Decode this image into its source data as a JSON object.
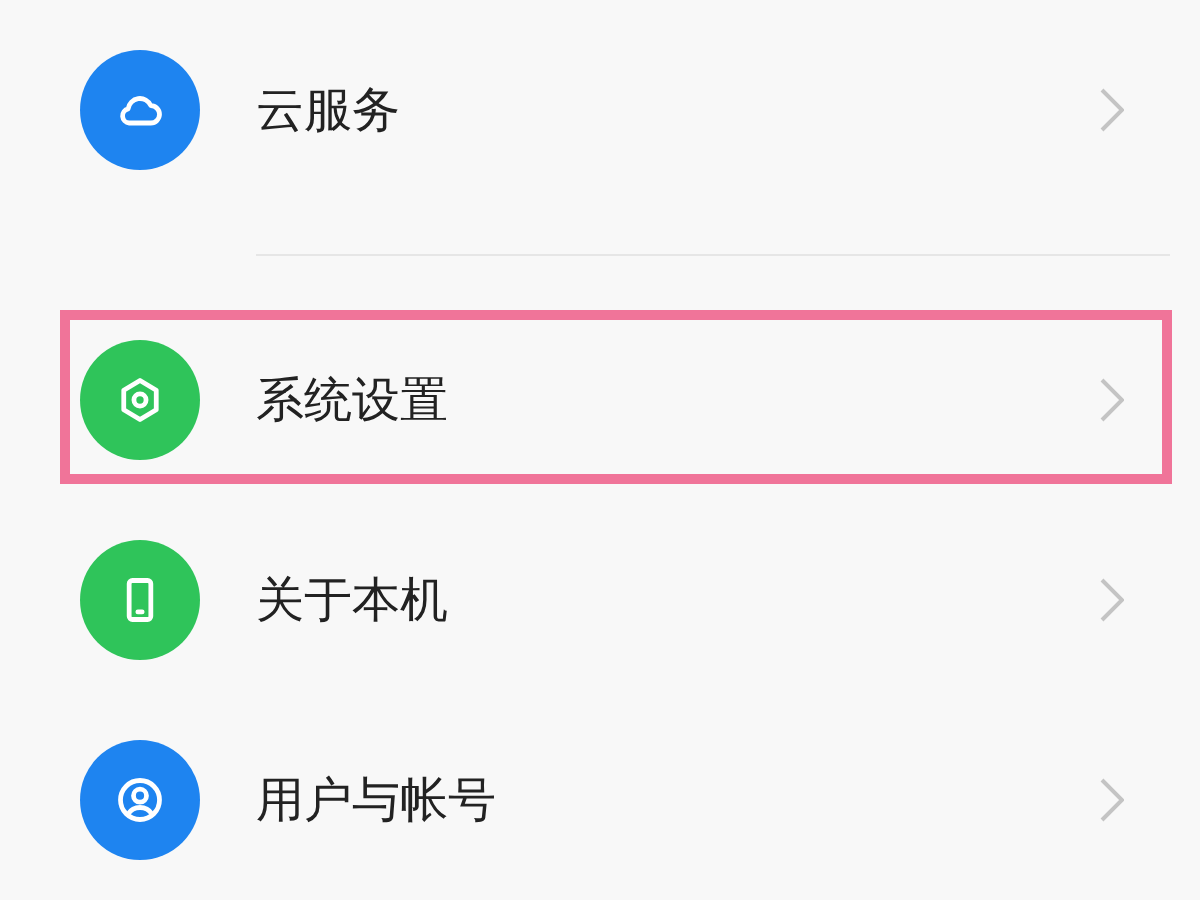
{
  "sections": [
    {
      "items": [
        {
          "label": "云服务",
          "color": "#1e84f0",
          "highlighted": false
        }
      ]
    },
    {
      "items": [
        {
          "label": "系统设置",
          "color": "#2fc45a",
          "highlighted": true
        },
        {
          "label": "关于本机",
          "color": "#2fc45a",
          "highlighted": false
        },
        {
          "label": "用户与帐号",
          "color": "#1e84f0",
          "highlighted": false
        }
      ]
    }
  ]
}
